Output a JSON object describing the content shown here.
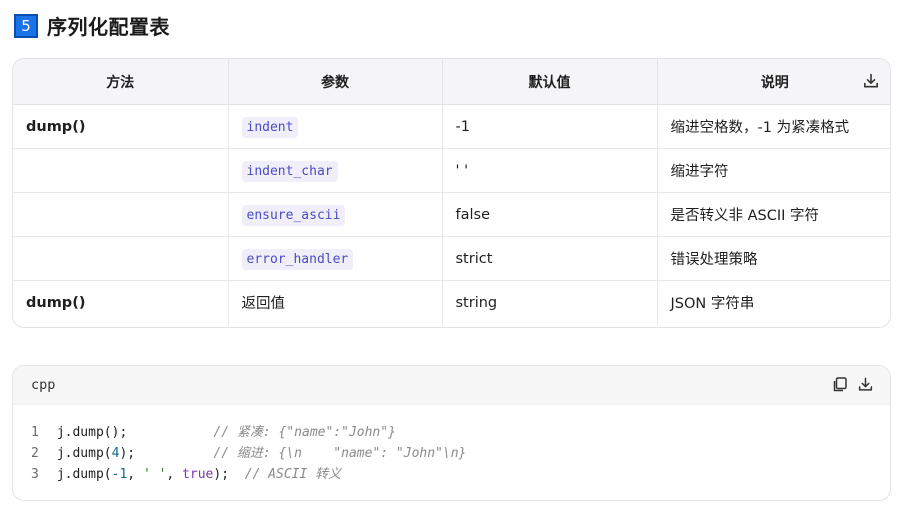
{
  "heading": {
    "number": "5",
    "title": "序列化配置表"
  },
  "table": {
    "headers": [
      "方法",
      "参数",
      "默认值",
      "说明"
    ],
    "download_icon": "download-icon",
    "rows": [
      {
        "method": "dump()",
        "param": "indent",
        "param_code": true,
        "default": "-1",
        "desc": "缩进空格数，-1 为紧凑格式"
      },
      {
        "method": "",
        "param": "indent_char",
        "param_code": true,
        "default": "' '",
        "desc": "缩进字符"
      },
      {
        "method": "",
        "param": "ensure_ascii",
        "param_code": true,
        "default": "false",
        "desc": "是否转义非 ASCII 字符"
      },
      {
        "method": "",
        "param": "error_handler",
        "param_code": true,
        "default": "strict",
        "desc": "错误处理策略"
      },
      {
        "method": "dump()",
        "param": "返回值",
        "param_code": false,
        "default": "string",
        "desc": "JSON 字符串"
      }
    ]
  },
  "code": {
    "language": "cpp",
    "copy_icon": "copy-icon",
    "download_icon": "download-icon",
    "lines": [
      {
        "n": "1",
        "code": "j.dump();",
        "pad": "           ",
        "comment": "// 紧凑: {\"name\":\"John\"}"
      },
      {
        "n": "2",
        "code": "j.dump(4);",
        "pad": "          ",
        "comment": "// 缩进: {\\n    \"name\": \"John\"\\n}"
      },
      {
        "n": "3",
        "code": "j.dump(-1, ' ', true);",
        "pad": "  ",
        "comment": "// ASCII 转义"
      }
    ]
  }
}
